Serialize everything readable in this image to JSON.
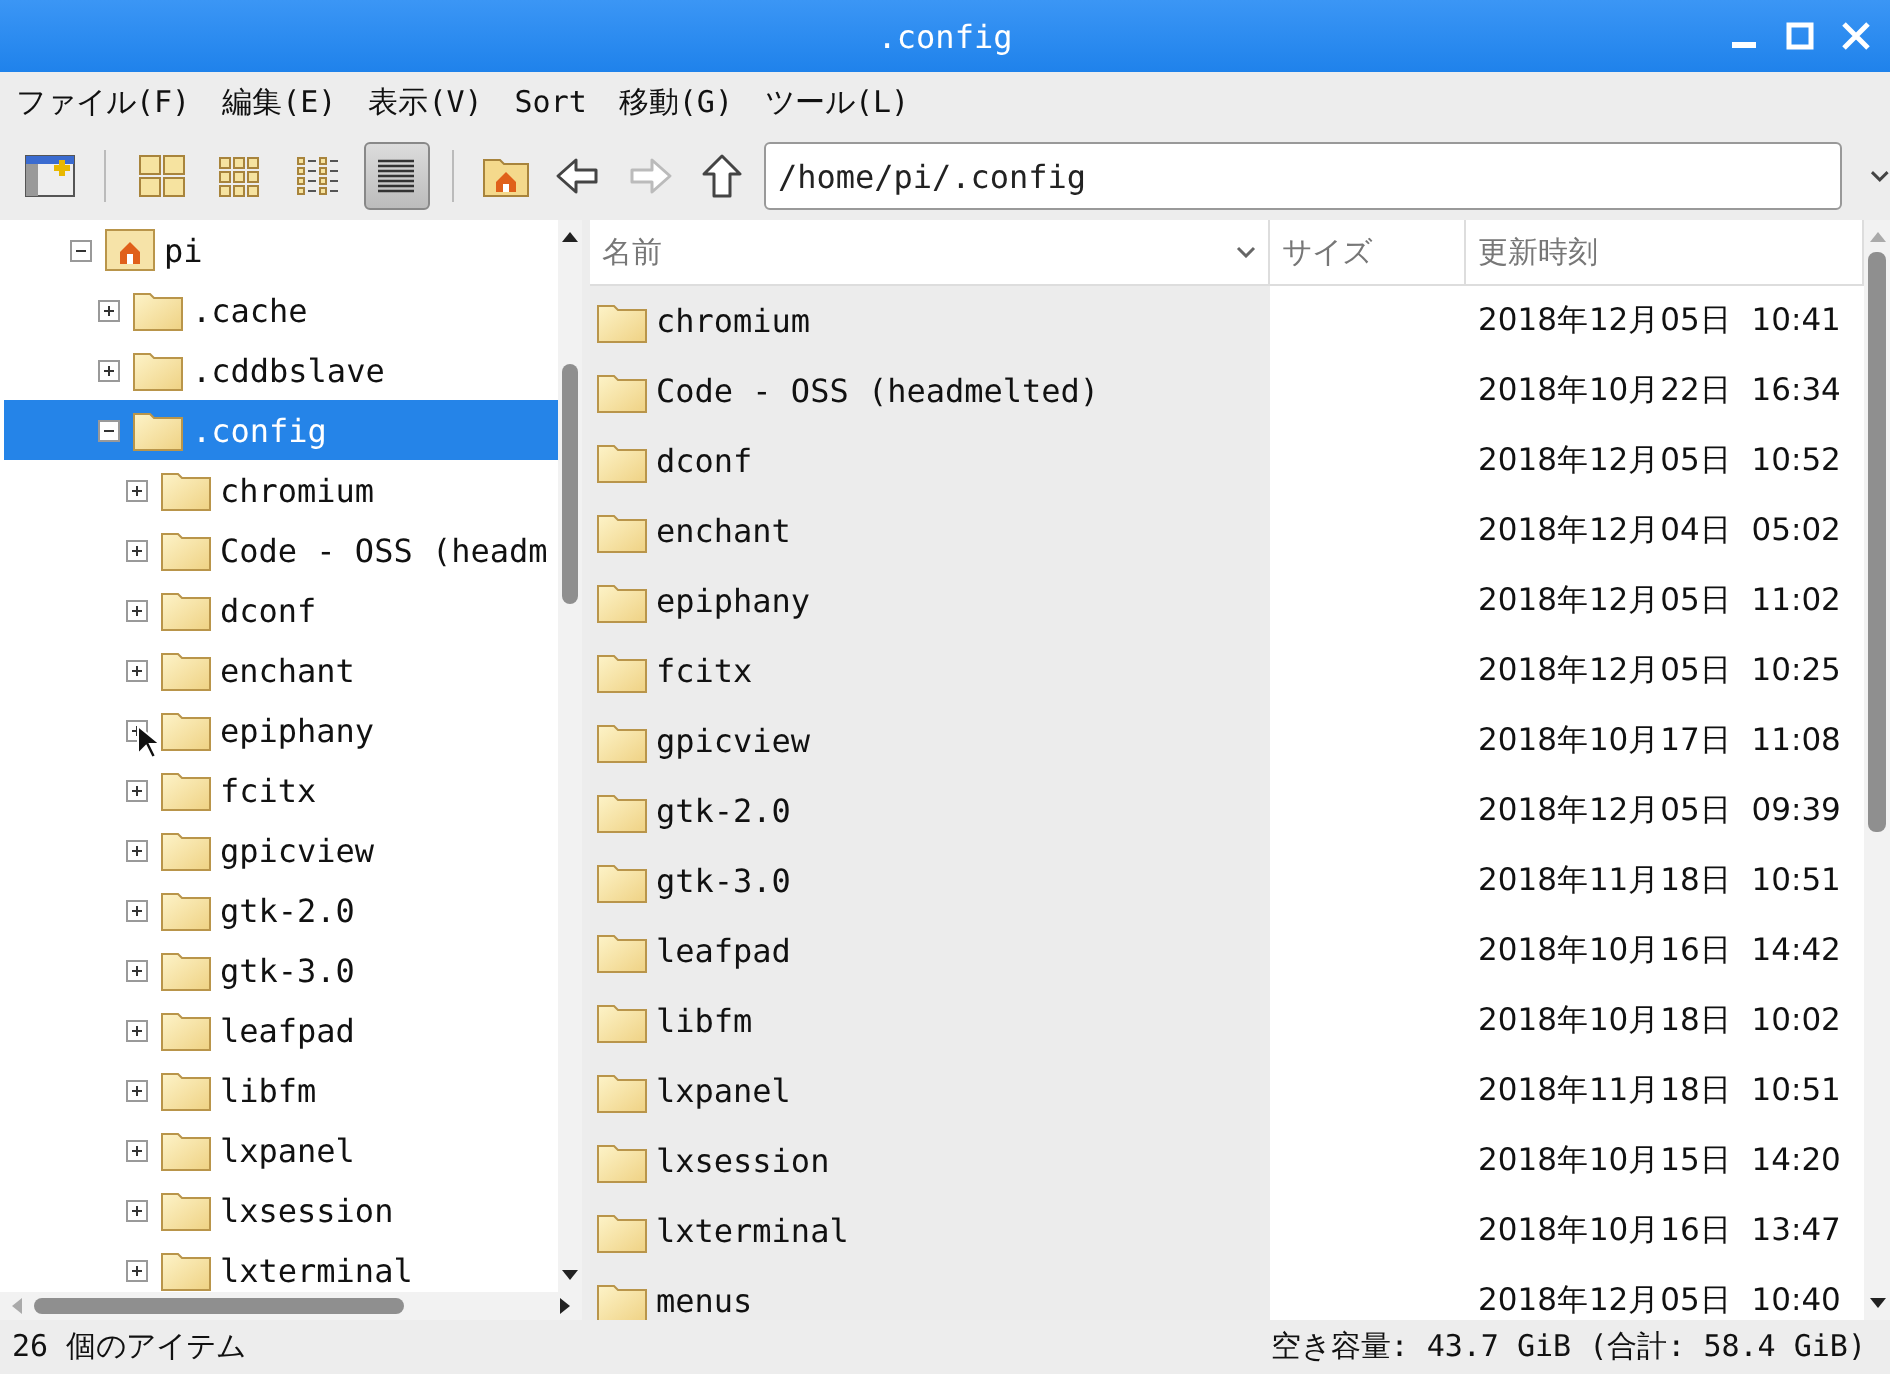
{
  "window": {
    "title": ".config"
  },
  "menu": [
    "ファイル(F)",
    "編集(E)",
    "表示(V)",
    "Sort",
    "移動(G)",
    "ツール(L)"
  ],
  "toolbar": {
    "view_modes": [
      {
        "kind": "icons",
        "selected": false
      },
      {
        "kind": "thumbnails",
        "selected": false
      },
      {
        "kind": "compact",
        "selected": false
      },
      {
        "kind": "details",
        "selected": true
      }
    ],
    "forward_disabled": true,
    "path": "/home/pi/.config"
  },
  "tree": [
    {
      "name": "pi",
      "kind": "home",
      "expanded": true,
      "selected": false,
      "children": [
        {
          "name": ".cache",
          "kind": "folder",
          "expanded": false,
          "selected": false
        },
        {
          "name": ".cddbslave",
          "kind": "folder",
          "expanded": false,
          "selected": false
        },
        {
          "name": ".config",
          "kind": "folder",
          "expanded": true,
          "selected": true,
          "children": [
            {
              "name": "chromium",
              "kind": "folder",
              "expanded": false,
              "selected": false
            },
            {
              "name": "Code - OSS (headm",
              "kind": "folder",
              "expanded": false,
              "selected": false
            },
            {
              "name": "dconf",
              "kind": "folder",
              "expanded": false,
              "selected": false
            },
            {
              "name": "enchant",
              "kind": "folder",
              "expanded": false,
              "selected": false
            },
            {
              "name": "epiphany",
              "kind": "folder",
              "expanded": false,
              "selected": false
            },
            {
              "name": "fcitx",
              "kind": "folder",
              "expanded": false,
              "selected": false
            },
            {
              "name": "gpicview",
              "kind": "folder",
              "expanded": false,
              "selected": false
            },
            {
              "name": "gtk-2.0",
              "kind": "folder",
              "expanded": false,
              "selected": false
            },
            {
              "name": "gtk-3.0",
              "kind": "folder",
              "expanded": false,
              "selected": false
            },
            {
              "name": "leafpad",
              "kind": "folder",
              "expanded": false,
              "selected": false
            },
            {
              "name": "libfm",
              "kind": "folder",
              "expanded": false,
              "selected": false
            },
            {
              "name": "lxpanel",
              "kind": "folder",
              "expanded": false,
              "selected": false
            },
            {
              "name": "lxsession",
              "kind": "folder",
              "expanded": false,
              "selected": false
            },
            {
              "name": "lxterminal",
              "kind": "folder",
              "expanded": false,
              "selected": false
            }
          ]
        }
      ]
    }
  ],
  "table": {
    "columns": [
      "名前",
      "サイズ",
      "更新時刻"
    ],
    "rows": [
      {
        "name": "chromium",
        "modified": "2018年12月05日  10:41"
      },
      {
        "name": "Code - OSS (headmelted)",
        "modified": "2018年10月22日  16:34"
      },
      {
        "name": "dconf",
        "modified": "2018年12月05日  10:52"
      },
      {
        "name": "enchant",
        "modified": "2018年12月04日  05:02"
      },
      {
        "name": "epiphany",
        "modified": "2018年12月05日  11:02"
      },
      {
        "name": "fcitx",
        "modified": "2018年12月05日  10:25"
      },
      {
        "name": "gpicview",
        "modified": "2018年10月17日  11:08"
      },
      {
        "name": "gtk-2.0",
        "modified": "2018年12月05日  09:39"
      },
      {
        "name": "gtk-3.0",
        "modified": "2018年11月18日  10:51"
      },
      {
        "name": "leafpad",
        "modified": "2018年10月16日  14:42"
      },
      {
        "name": "libfm",
        "modified": "2018年10月18日  10:02"
      },
      {
        "name": "lxpanel",
        "modified": "2018年11月18日  10:51"
      },
      {
        "name": "lxsession",
        "modified": "2018年10月15日  14:20"
      },
      {
        "name": "lxterminal",
        "modified": "2018年10月16日  13:47"
      },
      {
        "name": "menus",
        "modified": "2018年12月05日  10:40"
      }
    ]
  },
  "status_bar": {
    "items": "26 個のアイテム",
    "free_space": "空き容量: 43.7 GiB (合計: 58.4 GiB)"
  }
}
